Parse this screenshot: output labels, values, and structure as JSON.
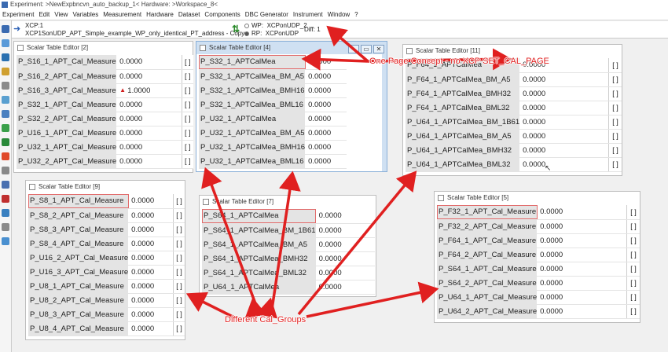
{
  "window": {
    "title": "Experiment: >NewExpbncvn_auto_backup_1< Hardware: >Workspace_8<"
  },
  "menu": [
    "Experiment",
    "Edit",
    "View",
    "Variables",
    "Measurement",
    "Hardware",
    "Dataset",
    "Components",
    "DBC Generator",
    "Instrument",
    "Window",
    "?"
  ],
  "xcp": {
    "device": "XCP:1",
    "description": "XCP1SonUDP_APT_Simple_example_WP_only_identical_PT_address - Copy",
    "wp_label": "WP:",
    "wp_value": "XCPonUDP_2",
    "rp_label": "RP:",
    "rp_value": "XCPonUDP",
    "diff": "Diff: 1"
  },
  "panels": {
    "p2": {
      "title": "Scalar Table Editor [2]",
      "rows": [
        {
          "name": "P_S16_1_APT_Cal_Measure",
          "value": "0.0000",
          "unit": "[ ]"
        },
        {
          "name": "P_S16_2_APT_Cal_Measure",
          "value": "0.0000",
          "unit": "[ ]"
        },
        {
          "name": "P_S16_3_APT_Cal_Measure",
          "value": "1.0000",
          "unit": "[ ]"
        },
        {
          "name": "P_S32_1_APT_Cal_Measure",
          "value": "0.0000",
          "unit": "[ ]"
        },
        {
          "name": "P_S32_2_APT_Cal_Measure",
          "value": "0.0000",
          "unit": "[ ]"
        },
        {
          "name": "P_U16_1_APT_Cal_Measure",
          "value": "0.0000",
          "unit": "[ ]"
        },
        {
          "name": "P_U32_1_APT_Cal_Measure",
          "value": "0.0000",
          "unit": "[ ]"
        },
        {
          "name": "P_U32_2_APT_Cal_Measure",
          "value": "0.0000",
          "unit": "[ ]"
        }
      ]
    },
    "p4": {
      "title": "Scalar Table Editor [4]",
      "buttons": [
        "–",
        "▭",
        "✕"
      ],
      "rows": [
        {
          "name": "P_S32_1_APTCalMea",
          "value": "0.0000"
        },
        {
          "name": "P_S32_1_APTCalMea_BM_A5",
          "value": "0.0000"
        },
        {
          "name": "P_S32_1_APTCalMea_BMH16",
          "value": "0.0000"
        },
        {
          "name": "P_S32_1_APTCalMea_BML16",
          "value": "0.0000"
        },
        {
          "name": "P_U32_1_APTCalMea",
          "value": "0.0000"
        },
        {
          "name": "P_U32_1_APTCalMea_BM_A5",
          "value": "0.0000"
        },
        {
          "name": "P_U32_1_APTCalMea_BMH16",
          "value": "0.0000"
        },
        {
          "name": "P_U32_1_APTCalMea_BML16",
          "value": "0.0000"
        }
      ]
    },
    "p11": {
      "title": "Scalar Table Editor [11]",
      "rows": [
        {
          "name": "P_F64_1_APTCalMea",
          "value": "0.0000",
          "unit": "[ ]"
        },
        {
          "name": "P_F64_1_APTCalMea_BM_A5",
          "value": "0.0000",
          "unit": "[ ]"
        },
        {
          "name": "P_F64_1_APTCalMea_BMH32",
          "value": "0.0000",
          "unit": "[ ]"
        },
        {
          "name": "P_F64_1_APTCalMea_BML32",
          "value": "0.0000",
          "unit": "[ ]"
        },
        {
          "name": "P_U64_1_APTCalMea_BM_1B61",
          "value": "0.0000",
          "unit": "[ ]"
        },
        {
          "name": "P_U64_1_APTCalMea_BM_A5",
          "value": "0.0000",
          "unit": "[ ]"
        },
        {
          "name": "P_U64_1_APTCalMea_BMH32",
          "value": "0.0000",
          "unit": "[ ]"
        },
        {
          "name": "P_U64_1_APTCalMea_BML32",
          "value": "0.0000",
          "unit": "[ ]"
        }
      ]
    },
    "p9": {
      "title": "Scalar Table Editor [9]",
      "rows": [
        {
          "name": "P_S8_1_APT_Cal_Measure",
          "value": "0.0000",
          "unit": "[ ]"
        },
        {
          "name": "P_S8_2_APT_Cal_Measure",
          "value": "0.0000",
          "unit": "[ ]"
        },
        {
          "name": "P_S8_3_APT_Cal_Measure",
          "value": "0.0000",
          "unit": "[ ]"
        },
        {
          "name": "P_S8_4_APT_Cal_Measure",
          "value": "0.0000",
          "unit": "[ ]"
        },
        {
          "name": "P_U16_2_APT_Cal_Measure",
          "value": "0.0000",
          "unit": "[ ]"
        },
        {
          "name": "P_U16_3_APT_Cal_Measure",
          "value": "0.0000",
          "unit": "[ ]"
        },
        {
          "name": "P_U8_1_APT_Cal_Measure",
          "value": "0.0000",
          "unit": "[ ]"
        },
        {
          "name": "P_U8_2_APT_Cal_Measure",
          "value": "0.0000",
          "unit": "[ ]"
        },
        {
          "name": "P_U8_3_APT_Cal_Measure",
          "value": "0.0000",
          "unit": "[ ]"
        },
        {
          "name": "P_U8_4_APT_Cal_Measure",
          "value": "0.0000",
          "unit": "[ ]"
        }
      ]
    },
    "p7": {
      "title": "Scalar Table Editor [7]",
      "rows": [
        {
          "name": "P_S64_1_APTCalMea",
          "value": "0.0000"
        },
        {
          "name": "P_S64_1_APTCalMea_BM_1B61",
          "value": "0.0000"
        },
        {
          "name": "P_S64_1_APTCalMea_BM_A5",
          "value": "0.0000"
        },
        {
          "name": "P_S64_1_APTCalMea_BMH32",
          "value": "0.0000"
        },
        {
          "name": "P_S64_1_APTCalMea_BML32",
          "value": "0.0000"
        },
        {
          "name": "P_U64_1_APTCalMea",
          "value": "0.0000"
        }
      ]
    },
    "p5": {
      "title": "Scalar Table Editor [5]",
      "rows": [
        {
          "name": "P_F32_1_APT_Cal_Measure",
          "value": "0.0000",
          "unit": "[ ]"
        },
        {
          "name": "P_F32_2_APT_Cal_Measure",
          "value": "0.0000",
          "unit": "[ ]"
        },
        {
          "name": "P_F64_1_APT_Cal_Measure",
          "value": "0.0000",
          "unit": "[ ]"
        },
        {
          "name": "P_F64_2_APT_Cal_Measure",
          "value": "0.0000",
          "unit": "[ ]"
        },
        {
          "name": "P_S64_1_APT_Cal_Measure",
          "value": "0.0000",
          "unit": "[ ]"
        },
        {
          "name": "P_S64_2_APT_Cal_Measure",
          "value": "0.0000",
          "unit": "[ ]"
        },
        {
          "name": "P_U64_1_APT_Cal_Measure",
          "value": "0.0000",
          "unit": "[ ]"
        },
        {
          "name": "P_U64_2_APT_Cal_Measure",
          "value": "0.0000",
          "unit": "[ ]"
        }
      ]
    }
  },
  "annotations": {
    "one_page": "One Page Concept - no XCP SET_CAL_PAGE",
    "groups": "Different Cal_Groups"
  },
  "colors": {
    "annotation": "#e02020",
    "name_cell": "#e4e4e4",
    "active_title": "#cfe0f2"
  }
}
